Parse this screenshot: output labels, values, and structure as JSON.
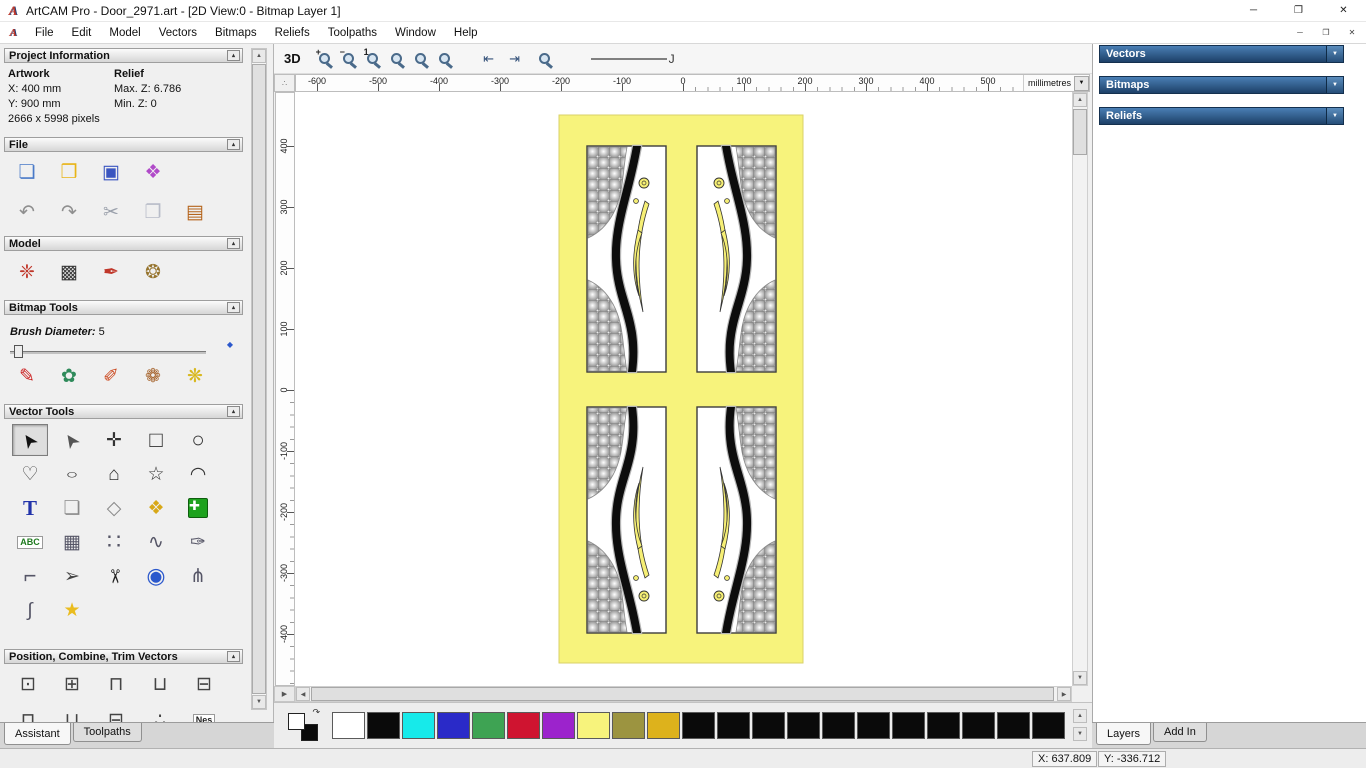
{
  "window": {
    "title": "ArtCAM Pro - Door_2971.art - [2D View:0 - Bitmap Layer 1]",
    "app_icon_glyph": "A",
    "controls": {
      "minimize": "─",
      "restore": "❐",
      "close": "✕"
    },
    "mdi_controls": {
      "minimize": "─",
      "restore": "❐",
      "close": "✕"
    }
  },
  "menu_bar": {
    "items": [
      "File",
      "Edit",
      "Model",
      "Vectors",
      "Bitmaps",
      "Reliefs",
      "Toolpaths",
      "Window",
      "Help"
    ]
  },
  "assistant": {
    "collapse_glyph": "▴",
    "project_information": {
      "title": "Project Information",
      "artwork_header": "Artwork",
      "relief_header": "Relief",
      "x_size": "X: 400 mm",
      "y_size": "Y: 900 mm",
      "pixels": "2666 x 5998 pixels",
      "max_z": "Max. Z: 6.786",
      "min_z": "Min. Z: 0"
    },
    "file": {
      "title": "File",
      "row1": [
        {
          "n": "new-model-icon",
          "g": "❏",
          "c": "#4a7ac8"
        },
        {
          "n": "open-model-icon",
          "g": "❒",
          "c": "#e8b418"
        },
        {
          "n": "save-model-icon",
          "g": "▣",
          "c": "#3a55c0"
        },
        {
          "n": "import-model-icon",
          "g": "❖",
          "c": "#b04ac8"
        }
      ],
      "row2": [
        {
          "n": "undo-icon",
          "g": "↶",
          "c": "#8f8f8f"
        },
        {
          "n": "redo-icon",
          "g": "↷",
          "c": "#8f8f8f"
        },
        {
          "n": "cut-icon",
          "g": "✂",
          "c": "#9aa0ab"
        },
        {
          "n": "copy-icon",
          "g": "❐",
          "c": "#b8bcc8"
        },
        {
          "n": "paste-icon",
          "g": "▤",
          "c": "#b5651d"
        }
      ]
    },
    "model": {
      "title": "Model",
      "row1": [
        {
          "n": "set-model-size-icon",
          "g": "❈",
          "c": "#c0372a"
        },
        {
          "n": "model-texture-icon",
          "g": "▩",
          "c": "#3a3a3a"
        },
        {
          "n": "model-lighthouse-icon",
          "g": "✒",
          "c": "#c0372a"
        },
        {
          "n": "model-portrait-icon",
          "g": "❂",
          "c": "#96742e"
        }
      ]
    },
    "bitmap_tools": {
      "title": "Bitmap Tools",
      "brush_label": "Brush Diameter:",
      "brush_value": "5",
      "slider_marker_glyph": "◆",
      "row1": [
        {
          "n": "paint-icon",
          "g": "✎",
          "c": "#cc2020"
        },
        {
          "n": "flood-fill-icon",
          "g": "✿",
          "c": "#2e8a5a"
        },
        {
          "n": "spray-icon",
          "g": "✐",
          "c": "#cc4a20"
        },
        {
          "n": "colour-cookie-icon",
          "g": "❁",
          "c": "#a5622a"
        },
        {
          "n": "solid-fill-icon",
          "g": "❋",
          "c": "#d8b81e"
        }
      ]
    },
    "vector_tools": {
      "title": "Vector Tools",
      "rows": [
        [
          {
            "n": "select-vectors-icon",
            "g": "➤",
            "c": "#111111",
            "cls": "rotUL",
            "box": "pressed"
          },
          {
            "n": "node-editing-icon",
            "g": "➤",
            "c": "#555555",
            "cls": "rotUL"
          },
          {
            "n": "transform-vectors-icon",
            "g": "✛",
            "c": "#333333"
          },
          {
            "n": "create-rectangle-icon",
            "g": "□",
            "c": "#333333",
            "cls": "big"
          },
          {
            "n": "create-circle-icon",
            "g": "○",
            "c": "#333333",
            "cls": "big"
          }
        ],
        [
          {
            "n": "create-polyline-icon",
            "g": "♡",
            "c": "#444444"
          },
          {
            "n": "create-ellipse-icon",
            "g": "○",
            "c": "#333333",
            "cls": "squish"
          },
          {
            "n": "create-polygon-icon",
            "g": "⌂",
            "c": "#333333"
          },
          {
            "n": "create-star-icon",
            "g": "☆",
            "c": "#333333"
          },
          {
            "n": "create-arc-icon",
            "g": "◠",
            "c": "#333333"
          }
        ],
        [
          {
            "n": "create-text-icon",
            "g": "T",
            "c": "#2233aa",
            "cls": "serifT"
          },
          {
            "n": "offset-vectors-icon",
            "g": "❏",
            "c": "#8a8a8a"
          },
          {
            "n": "create-diamond-icon",
            "g": "◇",
            "c": "#8a8a8a"
          },
          {
            "n": "fill-pour-icon",
            "g": "❖",
            "c": "#d8a818"
          },
          {
            "n": "block-paste-icon",
            "g": "✚",
            "c": "#ffffff",
            "cls": "greenbox"
          }
        ],
        [
          {
            "n": "text-abc-icon",
            "g": "ABC",
            "c": "#1f7a1f",
            "cls": "abcbox"
          },
          {
            "n": "wrap-text-icon",
            "g": "▦",
            "c": "#555566"
          },
          {
            "n": "block-copy-icon",
            "g": "∷",
            "c": "#555566",
            "cls": "big"
          },
          {
            "n": "copy-along-curve-icon",
            "g": "∿",
            "c": "#555566"
          },
          {
            "n": "vector-doctor-icon",
            "g": "✑",
            "c": "#555566"
          }
        ],
        [
          {
            "n": "fillet-icon",
            "g": "⌐",
            "c": "#555566",
            "cls": "big"
          },
          {
            "n": "join-vectors-icon",
            "g": "➢",
            "c": "#444444"
          },
          {
            "n": "trim-vectors-icon",
            "g": "✂",
            "c": "#222222",
            "cls": "rot90"
          },
          {
            "n": "interactive-distort-icon",
            "g": "◉",
            "c": "#2b58cc",
            "cls": "big"
          },
          {
            "n": "bridge-nodes-icon",
            "g": "⋔",
            "c": "#555566"
          }
        ],
        [
          {
            "n": "section-profile-icon",
            "g": "∫",
            "c": "#555566"
          },
          {
            "n": "vector-wizard-icon",
            "g": "★",
            "c": "#eabc1e"
          }
        ]
      ]
    },
    "position_tools": {
      "title": "Position, Combine, Trim Vectors",
      "row1": [
        {
          "n": "center-in-page-icon",
          "g": "⊡",
          "c": "#444444"
        },
        {
          "n": "align-centers-icon",
          "g": "⊞",
          "c": "#444444"
        },
        {
          "n": "align-top-icon",
          "g": "⊓",
          "c": "#444444"
        },
        {
          "n": "align-bottom-icon",
          "g": "⊔",
          "c": "#444444"
        },
        {
          "n": "align-edges-icon",
          "g": "⊟",
          "c": "#444444"
        }
      ],
      "row2": [
        {
          "n": "weld-vectors-icon",
          "g": "⊓",
          "c": "#444444"
        },
        {
          "n": "subtract-vectors-icon",
          "g": "⊔",
          "c": "#444444"
        },
        {
          "n": "slice-vectors-icon",
          "g": "⊟",
          "c": "#444444"
        },
        {
          "n": "scatter-copies-icon",
          "g": "∴",
          "c": "#444444"
        },
        {
          "n": "nest-vectors-icon",
          "g": "Nes",
          "c": "#222222",
          "cls": "abcbox"
        }
      ]
    },
    "tabs": [
      {
        "label": "Assistant",
        "active": true
      },
      {
        "label": "Toolpaths",
        "active": false
      }
    ]
  },
  "toolbar": {
    "view_3d_label": "3D",
    "zoom_tools": [
      {
        "n": "zoom-in-icon",
        "ov": "+"
      },
      {
        "n": "zoom-out-icon",
        "ov": "−"
      },
      {
        "n": "zoom-1to1-icon",
        "ov": "1"
      },
      {
        "n": "zoom-fit-icon",
        "ov": ""
      },
      {
        "n": "zoom-objects-icon",
        "ov": ""
      },
      {
        "n": "zoom-previous-icon",
        "ov": ""
      }
    ],
    "page_tools": [
      {
        "n": "previous-view-icon",
        "g": "⇤",
        "c": "#35527a"
      },
      {
        "n": "next-view-icon",
        "g": "⇥",
        "c": "#35527a"
      }
    ],
    "extra_zoom": [
      {
        "n": "zoom-window-icon",
        "ov": ""
      }
    ],
    "stroke_end_label": "J"
  },
  "rulers": {
    "horizontal_labels": [
      "-600",
      "-500",
      "-400",
      "-300",
      "-200",
      "-100",
      "0",
      "100",
      "200",
      "300",
      "400",
      "500"
    ],
    "vertical_labels": [
      "400",
      "300",
      "200",
      "100",
      "0",
      "-100",
      "-200",
      "-300",
      "-400"
    ],
    "units": "millimetres",
    "dropdown_glyph": "▼",
    "corner_glyph": "∴"
  },
  "right_panel": {
    "dropdown_glyph": "▼",
    "sections": [
      {
        "label": "Vectors"
      },
      {
        "label": "Bitmaps"
      },
      {
        "label": "Reliefs"
      }
    ],
    "tabs": [
      {
        "label": "Layers",
        "active": true
      },
      {
        "label": "Add In",
        "active": false
      }
    ]
  },
  "palette": {
    "swap_glyph": "↷",
    "colors": [
      "#ffffff",
      "#0a0a0a",
      "#17eaea",
      "#2a2ac8",
      "#3ea353",
      "#cf1430",
      "#9c23cc",
      "#f7f37c",
      "#9c9440",
      "#ddb21c",
      "#0a0a0a",
      "#0a0a0a",
      "#0a0a0a",
      "#0a0a0a",
      "#0a0a0a",
      "#0a0a0a",
      "#0a0a0a",
      "#0a0a0a",
      "#0a0a0a",
      "#0a0a0a",
      "#0a0a0a"
    ]
  },
  "scrollbars": {
    "up": "▲",
    "down": "▼",
    "left": "◀",
    "right": "▶",
    "pane_toggle": "▶"
  },
  "status_bar": {
    "x_coordinate": "X: 637.809",
    "y_coordinate": "Y: -336.712"
  },
  "colors": {
    "canvas_yellow": "#f7f37c",
    "header_blue": "#1d4068"
  }
}
